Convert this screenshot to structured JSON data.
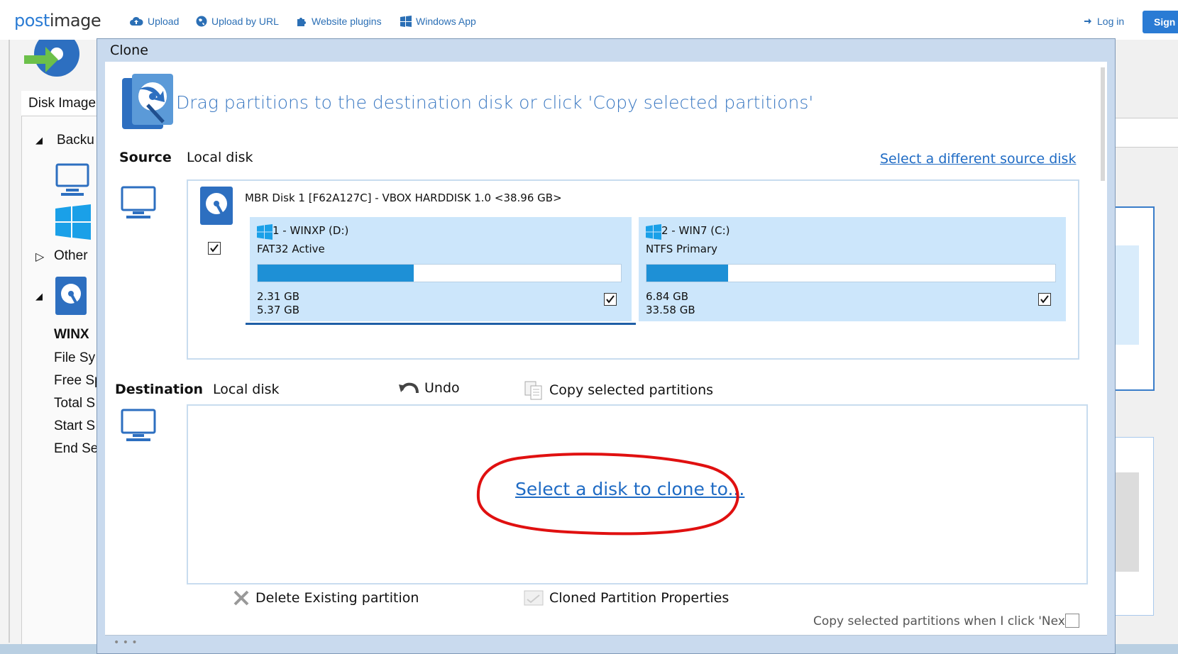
{
  "browser": {
    "logo": {
      "part1": "post",
      "part2": "image"
    },
    "nav": [
      {
        "label": "Upload",
        "icon": "cloud-upload-icon"
      },
      {
        "label": "Upload by URL",
        "icon": "globe-icon"
      },
      {
        "label": "Website plugins",
        "icon": "puzzle-icon"
      },
      {
        "label": "Windows App",
        "icon": "windows-icon"
      }
    ],
    "login": "Log in",
    "signup": "Sign u"
  },
  "background_app": {
    "tab": "Disk Image",
    "tree": [
      "Backu",
      "Other",
      "WINX",
      "File Sy",
      "Free Sp",
      "Total S",
      "Start S",
      "End Se"
    ]
  },
  "dialog": {
    "title": "Clone",
    "header": "Drag partitions to the destination disk or click 'Copy selected partitions'",
    "source": {
      "label": "Source",
      "kind": "Local disk",
      "change_link": "Select a different source disk",
      "disk_title": "MBR Disk 1 [F62A127C] - VBOX HARDDISK 1.0  <38.96 GB>",
      "disk_checked": true,
      "partitions": [
        {
          "name": "1 - WINXP (D:)",
          "fs": "FAT32 Active",
          "used": "2.31 GB",
          "total": "5.37 GB",
          "used_fraction": 0.43,
          "checked": true
        },
        {
          "name": "2 - WIN7 (C:)",
          "fs": "NTFS Primary",
          "used": "6.84 GB",
          "total": "33.58 GB",
          "used_fraction": 0.2,
          "checked": true
        }
      ]
    },
    "destination": {
      "label": "Destination",
      "kind": "Local disk",
      "undo": "Undo",
      "copy": "Copy selected partitions",
      "select_link": "Select a disk to clone to..."
    },
    "actions": {
      "delete": "Delete Existing partition",
      "properties": "Cloned Partition Properties",
      "copy_on_next": "Copy selected partitions when I click 'Next'",
      "copy_on_next_checked": false
    },
    "colors": {
      "accent": "#1e90d6",
      "partition_bg": "#cce6fb",
      "link": "#1f6bc4",
      "annotation": "#e01010"
    }
  }
}
